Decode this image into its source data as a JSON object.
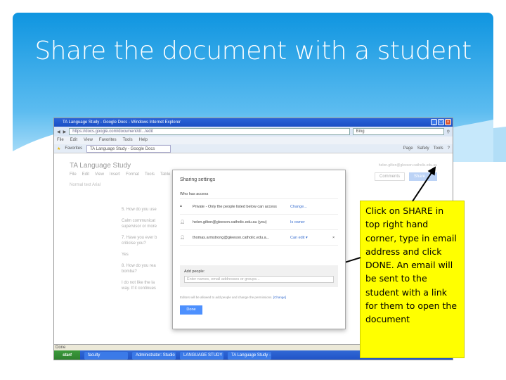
{
  "slide": {
    "title": "Share the document with a student",
    "callout": "Click on SHARE  in top right hand corner, type in email address and click  DONE. An email will be sent to the student with a link for them to open the document"
  },
  "browser": {
    "window_title": "TA Language Study - Google Docs - Windows Internet Explorer",
    "url": "https://docs.google.com/document/d/.../edit",
    "search": "Bing",
    "menu": [
      "File",
      "Edit",
      "View",
      "Favorites",
      "Tools",
      "Help"
    ],
    "favorites": "Favorites",
    "tab": "TA Language Study - Google Docs",
    "toolbar": [
      "Page",
      "Safety",
      "Tools"
    ],
    "status": "Done"
  },
  "doc": {
    "title": "TA Language Study",
    "menu": [
      "File",
      "Edit",
      "View",
      "Insert",
      "Format",
      "Tools",
      "Table"
    ],
    "toolbar": "Normal text   Arial",
    "user_email": "helen.gilton@gleeson.catholic.edu.au",
    "comments": "Comments",
    "share": "Share",
    "body": [
      "5. How do you use",
      "Calm communicat",
      "supervisor or more",
      "7. Have you ever b",
      "criticise you?",
      "Yes",
      "8. How do you rea",
      "bomba?",
      "I do not like the la",
      "way. If it continues"
    ]
  },
  "dialog": {
    "title": "Sharing settings",
    "who": "Who has access",
    "rows": [
      {
        "name": "Private - Only the people listed below can access",
        "action": "Change..."
      },
      {
        "name": "helen.gilton@gleeson.catholic.edu.au (you)",
        "action": "Is owner"
      },
      {
        "name": "thomas.armstrong@gleeson.catholic.edu.a...",
        "action": "Can edit ▾",
        "remove": "×"
      }
    ],
    "add_label": "Add people:",
    "add_placeholder": "Enter names, email addresses or groups...",
    "note": "Editors will be allowed to add people and change the permissions.",
    "note_link": "[Change]",
    "done": "Done"
  },
  "taskbar": {
    "start": "start",
    "items": [
      "faculty",
      "Administrator: Studio",
      "LANGUAGE STUDY",
      "TA Language Study - ..."
    ]
  }
}
